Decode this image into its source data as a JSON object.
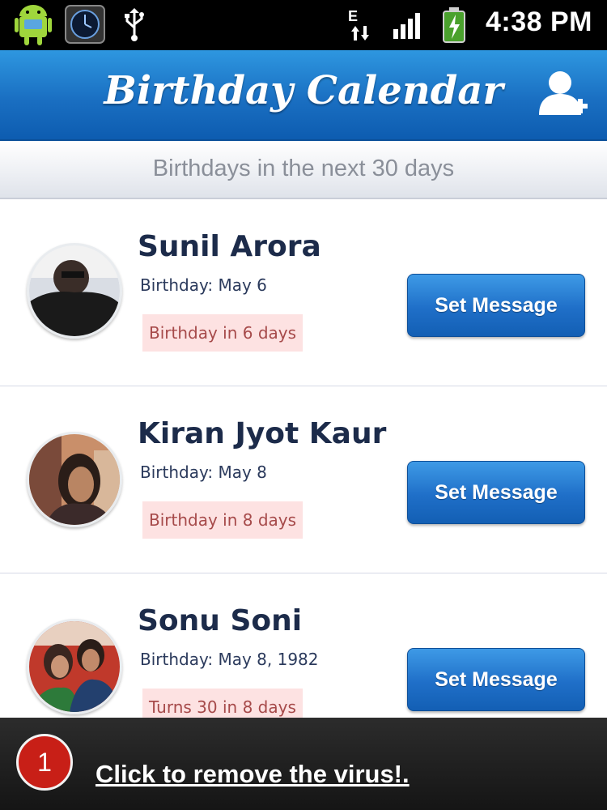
{
  "status_bar": {
    "network_type": "E",
    "time": "4:38 PM",
    "icons": [
      "android-icon",
      "clock-app-icon",
      "usb-icon",
      "edge-data-icon",
      "signal-icon",
      "battery-icon"
    ]
  },
  "app_bar": {
    "title": "Birthday Calendar",
    "action_icon": "add-contact-icon",
    "color": "#1a6fc2"
  },
  "subheader": {
    "text": "Birthdays in the next 30 days"
  },
  "contacts": [
    {
      "name": "Sunil Arora",
      "birthday": "Birthday: May 6",
      "badge": "Birthday in 6 days",
      "button": "Set Message"
    },
    {
      "name": "Kiran Jyot Kaur",
      "birthday": "Birthday: May 8",
      "badge": "Birthday in 8 days",
      "button": "Set Message"
    },
    {
      "name": "Sonu Soni",
      "birthday": "Birthday: May 8, 1982",
      "badge": "Turns 30 in 8 days",
      "button": "Set Message"
    }
  ],
  "notification": {
    "count": "1",
    "link_text": "Click to remove the virus!.",
    "badge_color": "#c81f17"
  }
}
